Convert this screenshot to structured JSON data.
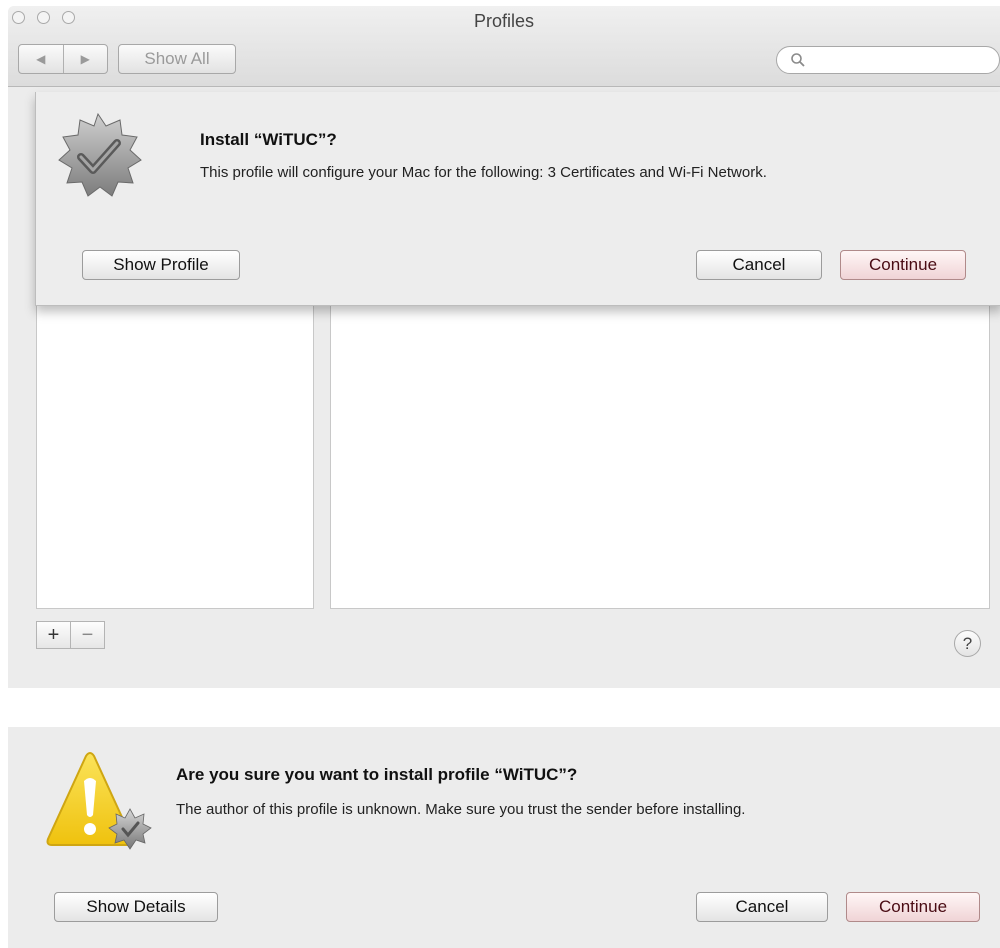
{
  "window": {
    "title": "Profiles",
    "nav_back": "◀",
    "nav_forward": "▶",
    "show_all_label": "Show All",
    "search_placeholder": "",
    "add_label": "+",
    "remove_label": "−",
    "help_label": "?"
  },
  "install_sheet": {
    "icon": "badge-checkmark-icon",
    "title": "Install “WiTUC”?",
    "message": "This profile will configure your Mac for the following: 3 Certificates and Wi-Fi Network.",
    "show_profile_label": "Show Profile",
    "cancel_label": "Cancel",
    "continue_label": "Continue"
  },
  "confirm_sheet": {
    "icon": "warning-icon",
    "title": "Are you sure you want to install profile “WiTUC”?",
    "message": "The author of this profile is unknown. Make sure you trust the sender before installing.",
    "show_details_label": "Show Details",
    "cancel_label": "Cancel",
    "continue_label": "Continue"
  },
  "colors": {
    "default_button_tint": "#f0d4d6",
    "warning_yellow": "#f5d21e",
    "window_bg": "#ececec"
  }
}
